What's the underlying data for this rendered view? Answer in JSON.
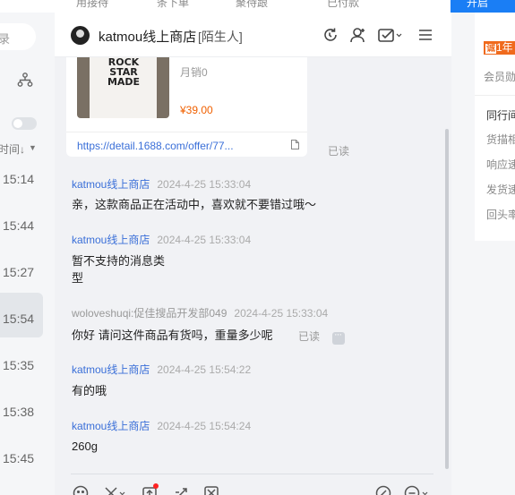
{
  "top_nav": {
    "tabs": [
      "用接待",
      "条下单",
      "聚待跟",
      "已付款"
    ],
    "button_label": "开启"
  },
  "sessions": {
    "search_placeholder": "录",
    "sort_label": "时间↓",
    "times": [
      "15:14",
      "15:44",
      "15:27",
      "15:54",
      "15:35",
      "15:38",
      "15:45"
    ]
  },
  "chat": {
    "shop_name": "katmou线上商店",
    "relation_tag": "[陌生人]",
    "product": {
      "image_text": "ROCK STAR MADE",
      "sales": "月销0",
      "price": "¥39.00",
      "link": "https://detail.1688.com/offer/77..."
    },
    "read_label": "已读",
    "messages": [
      {
        "sender": "katmou线上商店",
        "time": "2024-4-25 15:33:04",
        "text": "亲，这款商品正在活动中，喜欢就不要错过哦～"
      },
      {
        "sender": "katmou线上商店",
        "time": "2024-4-25 15:33:04",
        "text_lines": [
          "暂不支持的消息类",
          "型"
        ]
      },
      {
        "sender": "woloveshuqi:促佳搜品开发部049",
        "time": "2024-4-25 15:33:04",
        "text": "你好 请问这件商品有货吗，重量多少呢"
      },
      {
        "sender": "katmou线上商店",
        "time": "2024-4-25 15:54:22",
        "text": "有的哦"
      },
      {
        "sender": "katmou线上商店",
        "time": "2024-4-25 15:54:24",
        "text": "260g"
      }
    ]
  },
  "right_panel": {
    "badge_icon_text": "诚",
    "badge_text": "1年",
    "member_label": "会员勋",
    "section_title": "同行间",
    "stats": [
      "货描相",
      "响应速",
      "发货速",
      "回头率"
    ]
  },
  "colors": {
    "accent": "#3a6fd8",
    "price": "#f06000",
    "brand_blue": "#1a7ef5",
    "badge": "#f06a1d"
  },
  "icons": [
    "refresh-icon",
    "user-icon",
    "task-icon",
    "menu-icon",
    "emoji-icon",
    "scissors-icon",
    "upload-icon",
    "quick-reply-icon",
    "screenshot-icon",
    "send-icon",
    "more-icon"
  ]
}
